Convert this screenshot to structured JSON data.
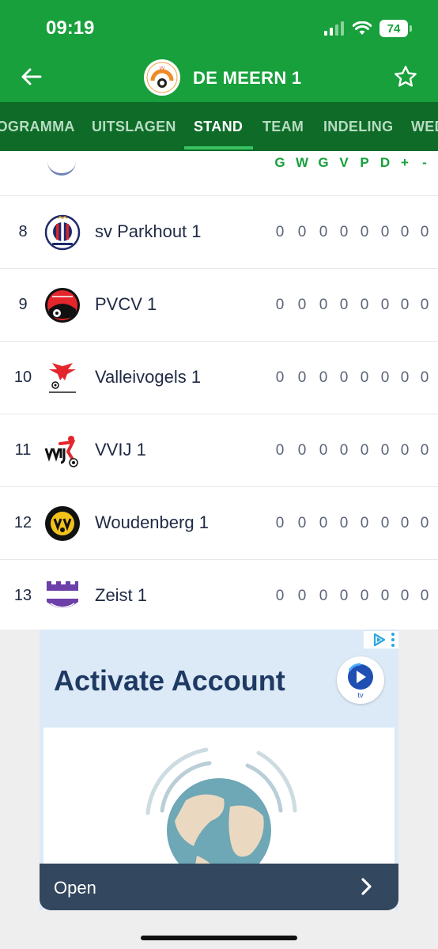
{
  "status_bar": {
    "time": "09:19",
    "battery": "74"
  },
  "header": {
    "title": "DE MEERN 1"
  },
  "tabs": [
    {
      "label": "PROGRAMMA"
    },
    {
      "label": "UITSLAGEN"
    },
    {
      "label": "STAND"
    },
    {
      "label": "TEAM"
    },
    {
      "label": "INDELING"
    },
    {
      "label": "WEDSTRIJDEN"
    }
  ],
  "columns": [
    "G",
    "W",
    "G",
    "V",
    "P",
    "D",
    "+",
    "-"
  ],
  "rows": [
    {
      "pos": "8",
      "team": "sv Parkhout 1",
      "logo": "parkhout-logo",
      "stats": [
        "0",
        "0",
        "0",
        "0",
        "0",
        "0",
        "0",
        "0"
      ]
    },
    {
      "pos": "9",
      "team": "PVCV 1",
      "logo": "pvcv-logo",
      "stats": [
        "0",
        "0",
        "0",
        "0",
        "0",
        "0",
        "0",
        "0"
      ]
    },
    {
      "pos": "10",
      "team": "Valleivogels 1",
      "logo": "valleivogels-logo",
      "stats": [
        "0",
        "0",
        "0",
        "0",
        "0",
        "0",
        "0",
        "0"
      ]
    },
    {
      "pos": "11",
      "team": "VVIJ 1",
      "logo": "vvij-logo",
      "stats": [
        "0",
        "0",
        "0",
        "0",
        "0",
        "0",
        "0",
        "0"
      ]
    },
    {
      "pos": "12",
      "team": "Woudenberg 1",
      "logo": "woudenberg-logo",
      "stats": [
        "0",
        "0",
        "0",
        "0",
        "0",
        "0",
        "0",
        "0"
      ]
    },
    {
      "pos": "13",
      "team": "Zeist 1",
      "logo": "zeist-logo",
      "stats": [
        "0",
        "0",
        "0",
        "0",
        "0",
        "0",
        "0",
        "0"
      ]
    }
  ],
  "ad": {
    "title": "Activate Account",
    "badge_text": "tv",
    "cta": "Open"
  },
  "colors": {
    "primary": "#17a03b",
    "tab_bar": "#0e6b28",
    "text": "#1f2a44",
    "stat": "#5b6478"
  },
  "icons": {
    "back": "arrow-left-icon",
    "favorite": "star-outline-icon",
    "ad_open": "chevron-right-icon"
  }
}
